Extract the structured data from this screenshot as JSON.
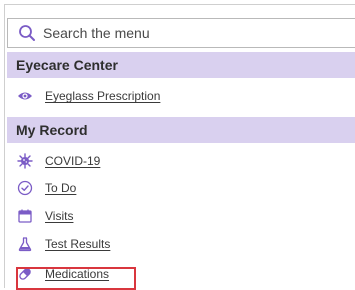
{
  "search": {
    "placeholder": "Search the menu"
  },
  "sections": {
    "eyecare": {
      "title": "Eyecare Center",
      "items": [
        {
          "label": "Eyeglass Prescription",
          "icon": "eye-icon"
        }
      ]
    },
    "my_record": {
      "title": "My Record",
      "items": [
        {
          "label": "COVID-19",
          "icon": "virus-icon"
        },
        {
          "label": "To Do",
          "icon": "checkmark-circle-icon"
        },
        {
          "label": "Visits",
          "icon": "calendar-icon"
        },
        {
          "label": "Test Results",
          "icon": "flask-icon"
        },
        {
          "label": "Medications",
          "icon": "pill-icon"
        }
      ]
    }
  },
  "colors": {
    "section_header_bg": "#d9d0ef",
    "accent_purple": "#7b5cc6",
    "highlight_border": "#d9363e"
  }
}
